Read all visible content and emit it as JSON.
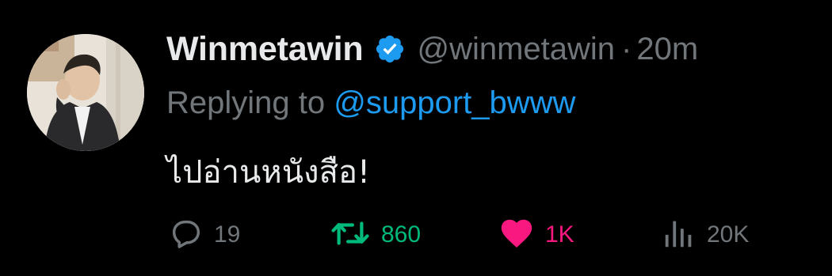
{
  "tweet": {
    "display_name": "Winmetawin",
    "handle": "@winmetawin",
    "separator": "·",
    "time": "20m",
    "replying_prefix": "Replying to ",
    "replying_handle": "@support_bwww",
    "text": "ไปอ่านหนังสือ!"
  },
  "actions": {
    "replies": "19",
    "retweets": "860",
    "likes": "1K",
    "views": "20K"
  },
  "icons": {
    "verified": "verified-badge-icon",
    "reply": "speech-bubble-icon",
    "retweet": "retweet-arrows-icon",
    "like": "heart-filled-icon",
    "views": "bar-chart-icon"
  },
  "colors": {
    "background": "#000000",
    "primary_text": "#e7e9ea",
    "secondary_text": "#71767b",
    "link": "#1d9bf0",
    "retweet_active": "#00ba7c",
    "like_active": "#f91880"
  }
}
